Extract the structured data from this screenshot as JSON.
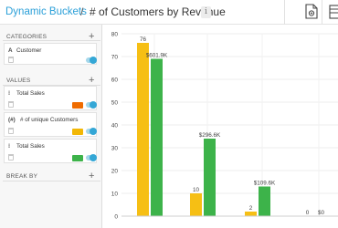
{
  "header": {
    "breadcrumb_root": "Dynamic Buckets",
    "separator": "/",
    "title": "# of Customers by Revenue",
    "info_icon": "info-icon",
    "doc_icon": "export-document-icon",
    "grid_icon": "grid-icon"
  },
  "panel": {
    "categories": {
      "title": "CATEGORIES",
      "items": [
        {
          "type_glyph": "A",
          "label": "Customer"
        }
      ]
    },
    "values": {
      "title": "VALUES",
      "items": [
        {
          "type_glyph": "#",
          "label": "Total Sales",
          "color": "#ef6c00"
        },
        {
          "type_glyph": "(#)",
          "label": "# of unique Customers",
          "color": "#f2b705"
        },
        {
          "type_glyph": "#",
          "label": "Total Sales",
          "color": "#3db34a"
        }
      ]
    },
    "break_by": {
      "title": "BREAK BY"
    },
    "add_icon": "+"
  },
  "chart_data": {
    "type": "bar",
    "categories": [
      "",
      "",
      "",
      ""
    ],
    "ylim": [
      0,
      80
    ],
    "yticks": [
      0,
      10,
      20,
      30,
      40,
      50,
      60,
      70,
      80
    ],
    "grid": true,
    "series": [
      {
        "values": [
          76,
          10,
          2,
          0
        ],
        "labels": [
          "76",
          "10",
          "2",
          "0"
        ],
        "color": "#f6bf14"
      },
      {
        "values": [
          69,
          34,
          13,
          0
        ],
        "labels": [
          "$601.9K",
          "$296.6K",
          "$109.6K",
          "$0"
        ],
        "color": "#3db34a"
      }
    ]
  }
}
